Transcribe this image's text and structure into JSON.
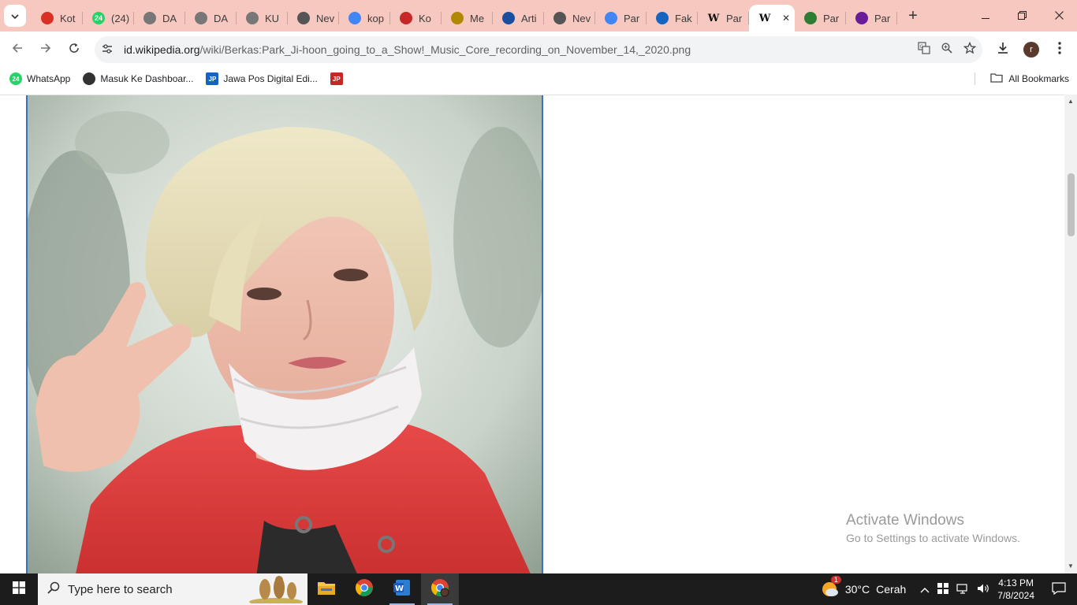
{
  "tabs": [
    {
      "title": "Kot",
      "icon": "gmail-icon",
      "color": "#d93025"
    },
    {
      "title": "(24)",
      "icon": "whatsapp-icon",
      "color": "#25d366"
    },
    {
      "title": "DA",
      "icon": "globe-icon",
      "color": "#777777"
    },
    {
      "title": "DA",
      "icon": "globe-icon",
      "color": "#777777"
    },
    {
      "title": "KU",
      "icon": "globe-icon",
      "color": "#777777"
    },
    {
      "title": "Nev",
      "icon": "incognito-icon",
      "color": "#555555"
    },
    {
      "title": "kop",
      "icon": "google-icon",
      "color": "#4285f4"
    },
    {
      "title": "Ko",
      "icon": "jawapos-icon",
      "color": "#c62828"
    },
    {
      "title": "Me",
      "icon": "shield-icon",
      "color": "#b08900"
    },
    {
      "title": "Arti",
      "icon": "news-icon",
      "color": "#1a4fa0"
    },
    {
      "title": "Nev",
      "icon": "incognito-icon",
      "color": "#555555"
    },
    {
      "title": "Par",
      "icon": "google-icon",
      "color": "#4285f4"
    },
    {
      "title": "Fak",
      "icon": "bookmark-icon",
      "color": "#1565c0"
    },
    {
      "title": "Par",
      "icon": "wikipedia-icon",
      "color": "#222222"
    },
    {
      "title": "",
      "icon": "wikipedia-icon",
      "color": "#222222",
      "active": true
    },
    {
      "title": "Par",
      "icon": "wikimedia-icon",
      "color": "#2e7d32"
    },
    {
      "title": "Par",
      "icon": "kpop-icon",
      "color": "#6a1b9a"
    }
  ],
  "toolbar": {
    "url_host": "id.wikipedia.org",
    "url_path": "/wiki/Berkas:Park_Ji-hoon_going_to_a_Show!_Music_Core_recording_on_November_14,_2020.png",
    "avatar_letter": "r"
  },
  "bookmarks": {
    "items": [
      {
        "label": "WhatsApp",
        "icon": "whatsapp-icon",
        "color": "#25d366"
      },
      {
        "label": "Masuk Ke Dashboar...",
        "icon": "globe-icon",
        "color": "#333333"
      },
      {
        "label": "Jawa Pos Digital Edi...",
        "icon": "jawapos-icon",
        "color": "#1565c0"
      },
      {
        "label": "",
        "icon": "jawapos-icon",
        "color": "#c62828"
      }
    ],
    "all_label": "All Bookmarks"
  },
  "watermark": {
    "line1": "Activate Windows",
    "line2": "Go to Settings to activate Windows."
  },
  "taskbar": {
    "search_placeholder": "Type here to search",
    "weather_temp": "30°C",
    "weather_text": "Cerah",
    "weather_badge": "1",
    "time": "4:13 PM",
    "date": "7/8/2024"
  }
}
